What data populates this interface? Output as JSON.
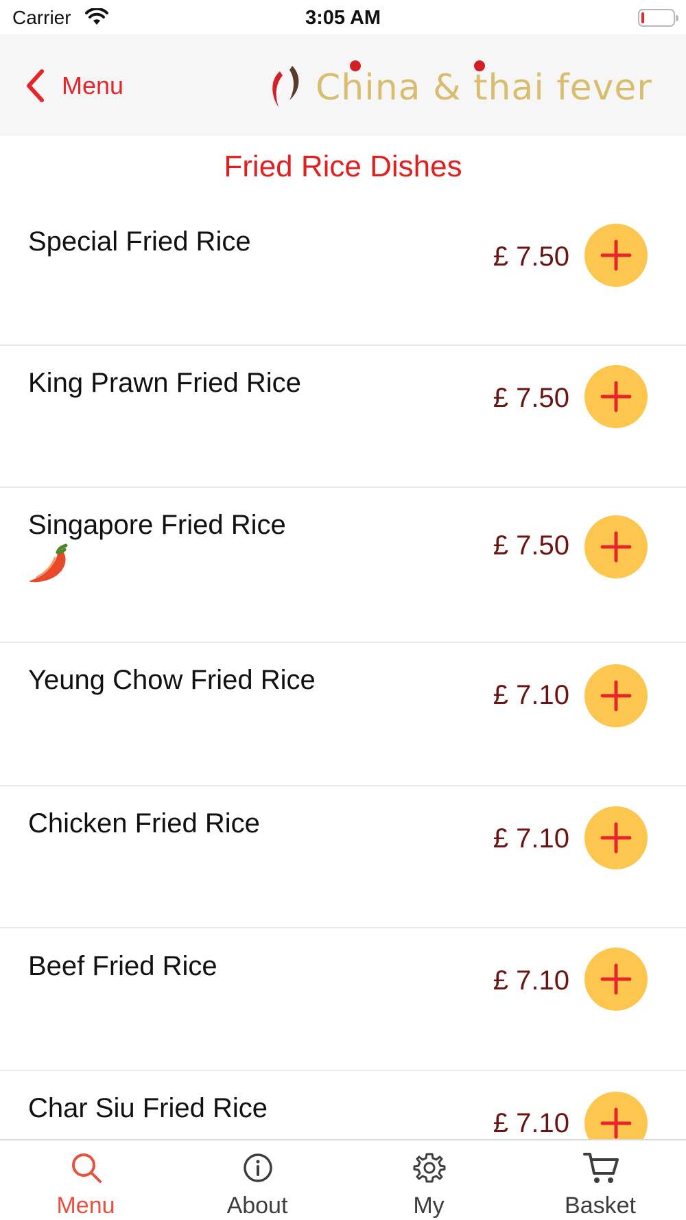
{
  "status_bar": {
    "carrier": "Carrier",
    "time": "3:05 AM",
    "wifi_icon": "wifi-icon",
    "battery_icon": "battery-low-icon",
    "battery_level": 0.1
  },
  "header": {
    "back_label": "Menu",
    "back_icon": "chevron-left-icon",
    "logo_text": "China & thai fever",
    "logo_icon": "koi-fish-logo"
  },
  "section": {
    "title": "Fried Rice Dishes"
  },
  "dishes": [
    {
      "name": "Special Fried Rice",
      "price": "£ 7.50",
      "spicy": false
    },
    {
      "name": "King Prawn Fried Rice",
      "price": "£ 7.50",
      "spicy": false
    },
    {
      "name": "Singapore Fried Rice",
      "price": "£ 7.50",
      "spicy": true
    },
    {
      "name": "Yeung Chow Fried Rice",
      "price": "£ 7.10",
      "spicy": false
    },
    {
      "name": "Chicken Fried Rice",
      "price": "£ 7.10",
      "spicy": false
    },
    {
      "name": "Beef Fried Rice",
      "price": "£ 7.10",
      "spicy": false
    },
    {
      "name": "Char Siu Fried Rice",
      "price": "£ 7.10",
      "spicy": false
    }
  ],
  "add_icon": "plus-icon",
  "spicy_icon": "chili-pepper-icon",
  "tabs": [
    {
      "label": "Menu",
      "icon": "search-icon",
      "active": true
    },
    {
      "label": "About",
      "icon": "info-icon",
      "active": false
    },
    {
      "label": "My",
      "icon": "gear-icon",
      "active": false
    },
    {
      "label": "Basket",
      "icon": "cart-icon",
      "active": false
    }
  ],
  "colors": {
    "accent_red": "#e5252a",
    "price_text": "#6b1414",
    "add_button": "#fdc64e",
    "logo_gold": "#d8bd6e",
    "active_tab": "#e8513f"
  }
}
